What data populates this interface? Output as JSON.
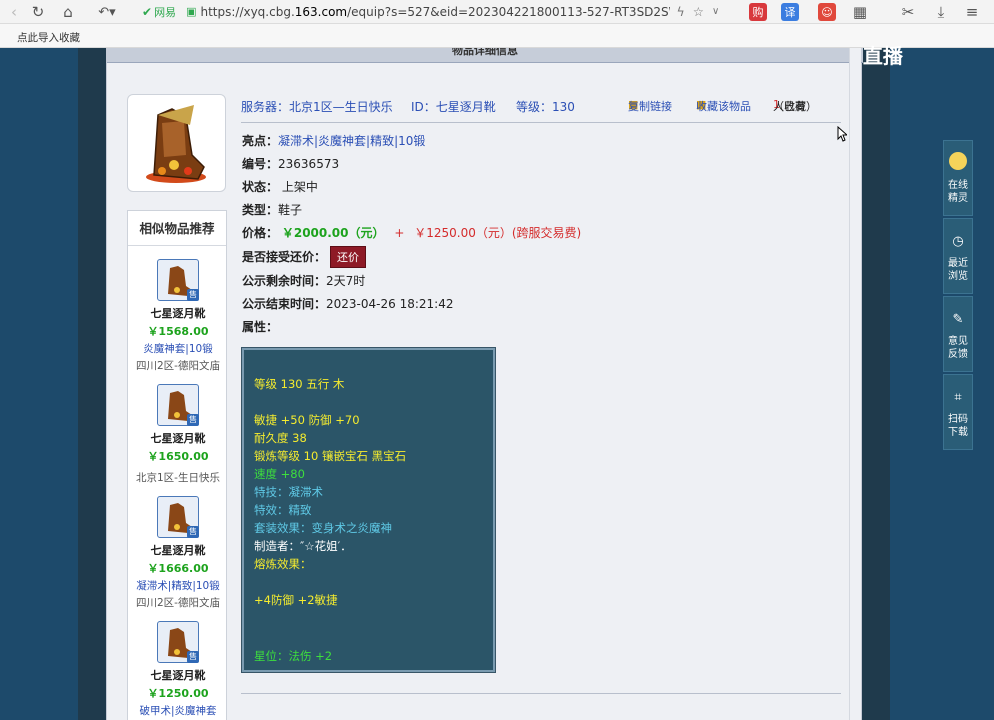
{
  "browser": {
    "nav": [
      "back",
      "forward",
      "refresh",
      "home",
      "undo"
    ],
    "site_label": "网易",
    "url_prefix": "https://xyq.cbg.",
    "url_host": "163.com",
    "url_rest": "/equip?s=527&eid=202304221800113-527-RT3SD2SWA2QV",
    "bookmark": "点此导入收藏",
    "ext_labels": [
      "购",
      "译"
    ]
  },
  "page_title": "物品详细信息",
  "overlay_logo": "CC直播",
  "header": {
    "server_label": "服务器：北京1区—生日快乐",
    "id_label": "ID：七星逐月靴",
    "level_label": "等级：130",
    "copy_link": "复制链接",
    "fav": "收藏该物品",
    "fav_count_pre": "（已有",
    "fav_count_num": "1",
    "fav_count_post": "人收藏）"
  },
  "details": {
    "highlight_label": "亮点：",
    "highlight_value": "凝滞术|炎魔神套|精致|10锻",
    "number_label": "编号：",
    "number_value": "23636573",
    "status_label": "状态：",
    "status_value": "上架中",
    "type_label": "类型：",
    "type_value": "鞋子",
    "price_label": "价格：",
    "price_value": "￥2000.00（元）",
    "price_plus": "+",
    "price_extra": "￥1250.00（元）",
    "price_note": "(跨服交易费)",
    "haggle_label": "是否接受还价：",
    "haggle_button": "还价",
    "remain_label": "公示剩余时间：",
    "remain_value": "2天7时",
    "end_label": "公示结束时间：",
    "end_value": "2023-04-26 18:21:42",
    "attr_label": "属性："
  },
  "attributes": [
    {
      "text": "等级 130  五行 木",
      "color": "y"
    },
    {
      "text": "敏捷 +50 防御 +70",
      "color": "y"
    },
    {
      "text": "耐久度 38",
      "color": "y"
    },
    {
      "text": "锻炼等级 10  镶嵌宝石 黑宝石",
      "color": "y"
    },
    {
      "text": "速度 +80",
      "color": "g"
    },
    {
      "text": "特技：凝滞术",
      "color": "c"
    },
    {
      "text": "特效：精致",
      "color": "c"
    },
    {
      "text": "套装效果：变身术之炎魔神",
      "color": "c"
    },
    {
      "text": "制造者：″☆花姐′．",
      "color": "w"
    },
    {
      "text": "熔炼效果：",
      "color": "y"
    },
    {
      "text": "+4防御 +2敏捷",
      "color": "y"
    },
    {
      "text": "星位：法伤 +2",
      "color": "g"
    }
  ],
  "similar": {
    "title": "相似物品推荐",
    "sell_badge": "售",
    "items": [
      {
        "name": "七星逐月靴",
        "price": "￥1568.00",
        "tags": "炎魔神套|10锻",
        "server": "四川2区-德阳文庙"
      },
      {
        "name": "七星逐月靴",
        "price": "￥1650.00",
        "tags": "",
        "server": "北京1区-生日快乐"
      },
      {
        "name": "七星逐月靴",
        "price": "￥1666.00",
        "tags": "凝滞术|精致|10锻",
        "server": "四川2区-德阳文庙"
      },
      {
        "name": "七星逐月靴",
        "price": "￥1250.00",
        "tags": "破甲术|炎魔神套",
        "server": ""
      }
    ]
  },
  "float_panel": [
    {
      "label1": "在线",
      "label2": "精灵",
      "icon": "sprite-icon"
    },
    {
      "label1": "最近",
      "label2": "浏览",
      "icon": "clock-icon"
    },
    {
      "label1": "意见",
      "label2": "反馈",
      "icon": "edit-icon"
    },
    {
      "label1": "扫码",
      "label2": "下载",
      "icon": "qr-icon"
    }
  ]
}
